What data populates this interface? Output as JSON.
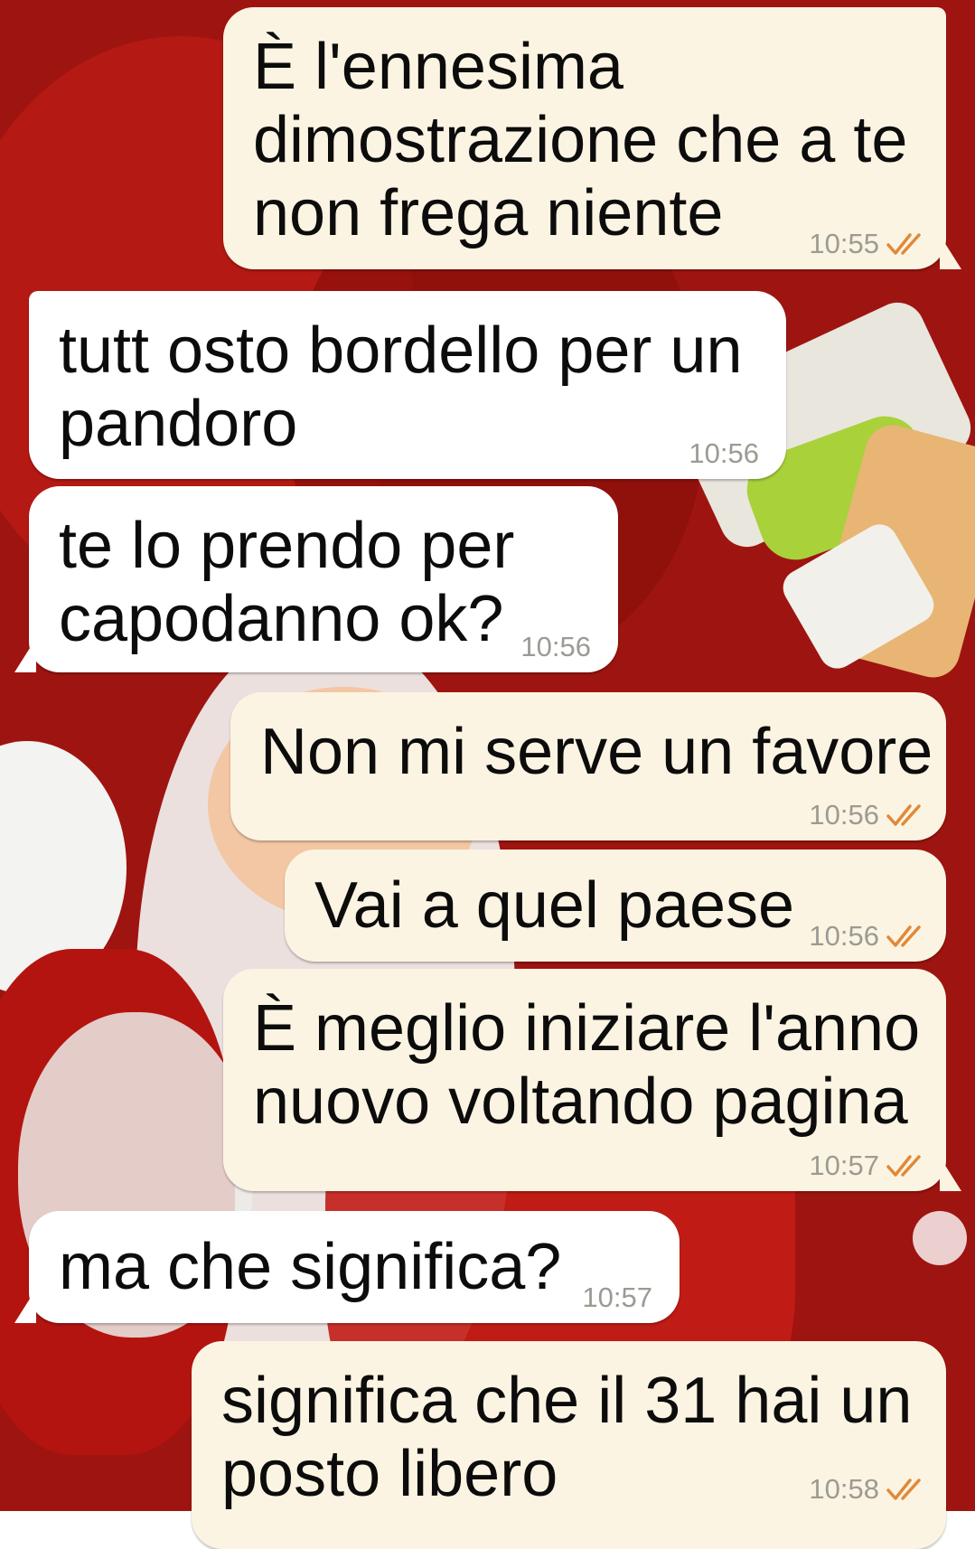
{
  "chat": {
    "messages": [
      {
        "direction": "outgoing",
        "text": "È l'ennesima\ndimostrazione che a te\nnon frega niente",
        "time": "10:55",
        "status_icon": "read-ticks-icon"
      },
      {
        "direction": "incoming",
        "text": "tutt osto bordello per un\npandoro",
        "time": "10:56"
      },
      {
        "direction": "incoming",
        "text": "te lo prendo per\ncapodanno ok?",
        "time": "10:56"
      },
      {
        "direction": "outgoing",
        "text": "Non mi serve un favore",
        "time": "10:56",
        "status_icon": "read-ticks-icon"
      },
      {
        "direction": "outgoing",
        "text": "Vai a quel paese",
        "time": "10:56",
        "status_icon": "read-ticks-icon"
      },
      {
        "direction": "outgoing",
        "text": "È meglio iniziare l'anno\nnuovo voltando pagina",
        "time": "10:57",
        "status_icon": "read-ticks-icon"
      },
      {
        "direction": "incoming",
        "text": "ma che significa?",
        "time": "10:57"
      },
      {
        "direction": "outgoing",
        "text": "significa che il 31 hai un\nposto libero",
        "time": "10:58",
        "status_icon": "read-ticks-icon"
      }
    ]
  },
  "colors": {
    "wallpaper_red": "#9e1410",
    "outgoing_bubble": "#fcf4e2",
    "incoming_bubble": "#ffffff",
    "timestamp": "#9b9b93",
    "tick": "#e0893a"
  },
  "wallpaper": {
    "icon": "santa-claus-wallpaper-icon"
  }
}
